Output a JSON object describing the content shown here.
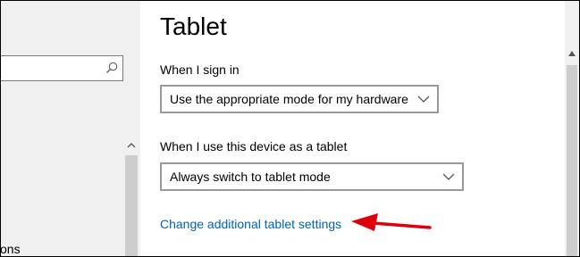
{
  "sidebar": {
    "search": {
      "value": "",
      "icon": "search-icon"
    },
    "partial_item_label": "ons"
  },
  "main": {
    "title": "Tablet",
    "sign_in": {
      "label": "When I sign in",
      "selected": "Use the appropriate mode for my hardware"
    },
    "tablet_use": {
      "label": "When I use this device as a tablet",
      "selected": "Always switch to tablet mode"
    },
    "additional_link": "Change additional tablet settings"
  },
  "colors": {
    "link": "#0063b1",
    "annotation_arrow": "#e0000b",
    "sidebar_background": "#f0f0f0",
    "dropdown_border": "#999999"
  }
}
